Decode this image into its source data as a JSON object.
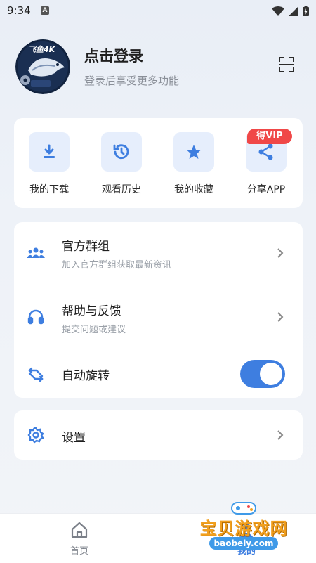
{
  "status_bar": {
    "time": "9:34",
    "notif_glyph": "A"
  },
  "profile": {
    "logo_text": "飞鱼4K",
    "title": "点击登录",
    "subtitle": "登录后享受更多功能",
    "scan_icon": "scan-icon"
  },
  "quick_actions": [
    {
      "label": "我的下载",
      "icon": "download-icon"
    },
    {
      "label": "观看历史",
      "icon": "history-icon"
    },
    {
      "label": "我的收藏",
      "icon": "star-icon"
    },
    {
      "label": "分享APP",
      "icon": "share-icon",
      "badge": "得VIP"
    }
  ],
  "menu": [
    {
      "title": "官方群组",
      "subtitle": "加入官方群组获取最新资讯",
      "icon": "group-icon"
    },
    {
      "title": "帮助与反馈",
      "subtitle": "提交问题或建议",
      "icon": "headset-icon"
    },
    {
      "title": "自动旋转",
      "icon": "rotate-icon",
      "toggle_on": true
    }
  ],
  "settings": {
    "title": "设置",
    "icon": "gear-icon"
  },
  "bottom_nav": {
    "home": "首页",
    "mine": "我的"
  },
  "watermark": {
    "title": "宝贝游戏网",
    "url": "baobeiy.com"
  },
  "colors": {
    "accent": "#3e7ee0",
    "icon_bg": "#e6eefc",
    "badge": "#f04848"
  }
}
